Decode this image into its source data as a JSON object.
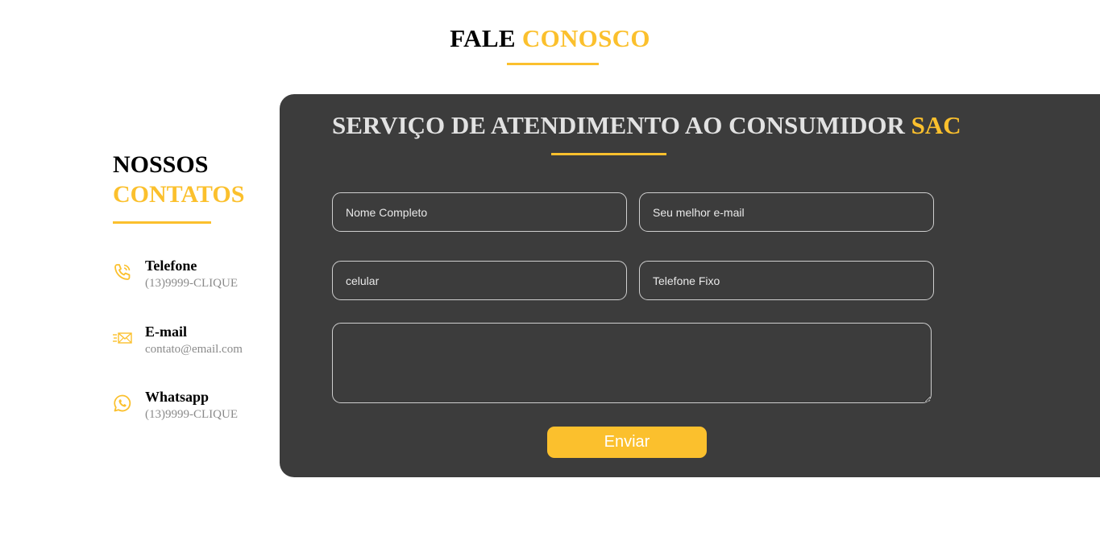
{
  "header": {
    "title_main": "FALE",
    "title_accent": "CONOSCO"
  },
  "contacts": {
    "heading_main": "NOSSOS",
    "heading_accent": "CONTATOS",
    "items": [
      {
        "icon": "phone-icon",
        "label": "Telefone",
        "value": "(13)9999-CLIQUE"
      },
      {
        "icon": "email-icon",
        "label": "E-mail",
        "value": "contato@email.com"
      },
      {
        "icon": "whatsapp-icon",
        "label": "Whatsapp",
        "value": "(13)9999-CLIQUE"
      }
    ]
  },
  "form": {
    "title_main": "SERVIÇO DE ATENDIMENTO AO CONSUMIDOR",
    "title_accent": "SAC",
    "fields": {
      "name_placeholder": "Nome Completo",
      "email_placeholder": "Seu melhor e-mail",
      "cell_placeholder": "celular",
      "phone_placeholder": "Telefone Fixo",
      "message_placeholder": ""
    },
    "submit_label": "Enviar"
  },
  "colors": {
    "accent": "#FBC02D",
    "panel": "#3c3c3c",
    "text_dark": "#000000",
    "muted": "#8a8a8a"
  }
}
